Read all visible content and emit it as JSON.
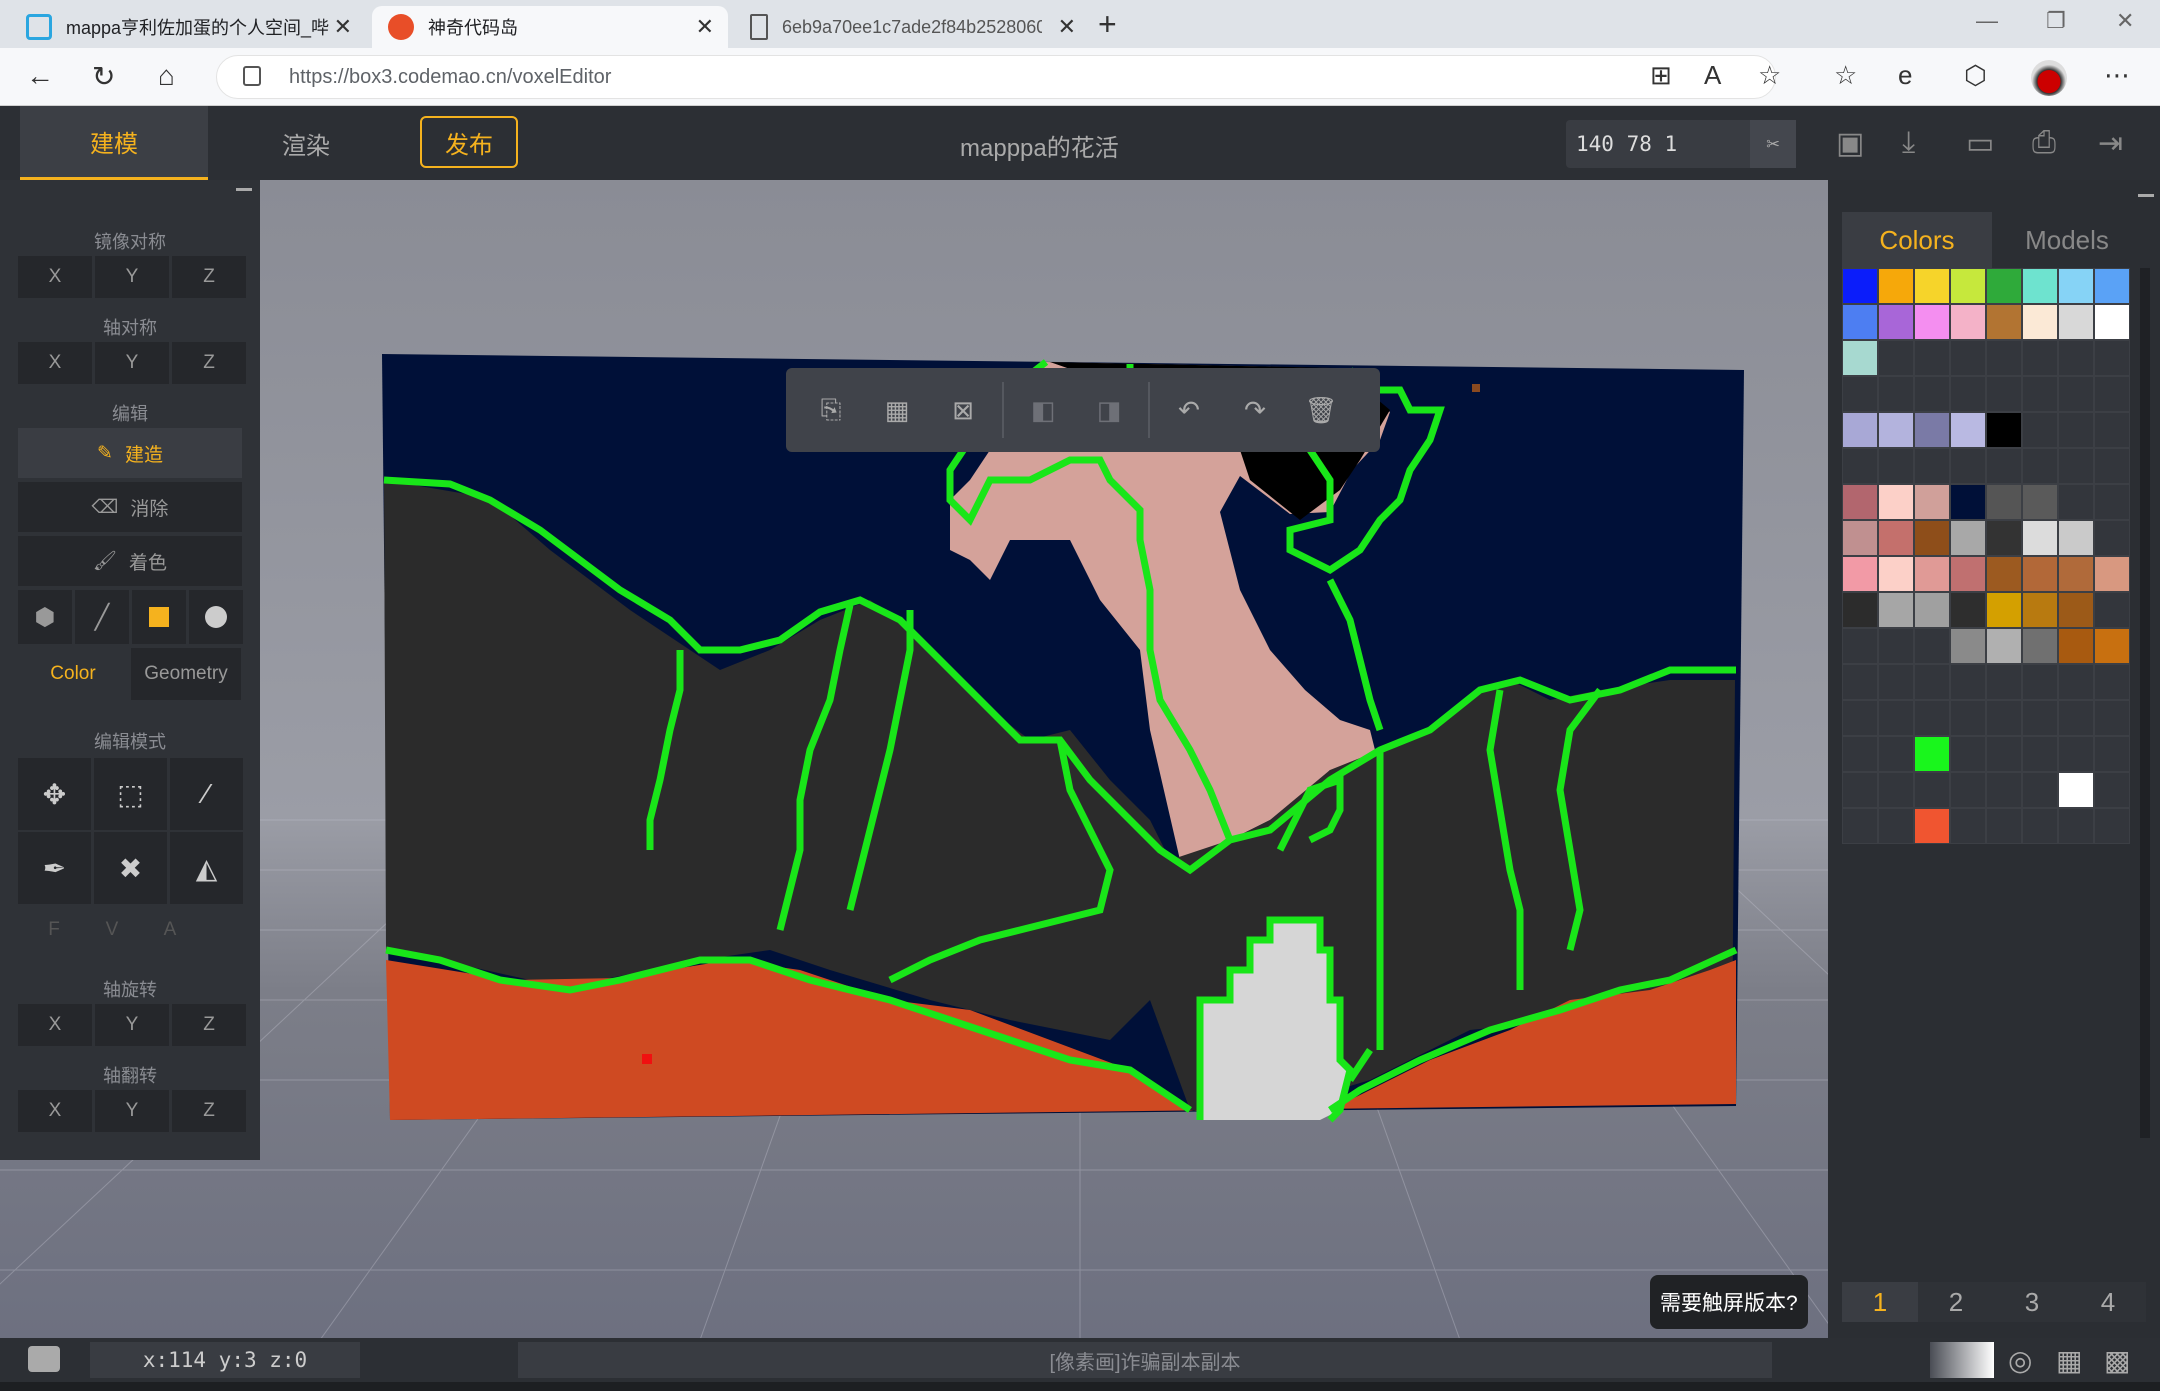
{
  "browser": {
    "tabs": [
      {
        "title": "mappa亨利佐加蛋的个人空间_哔",
        "icon": "bilibili-icon"
      },
      {
        "title": "神奇代码岛",
        "icon": "codemao-icon"
      },
      {
        "title": "6eb9a70ee1c7ade2f84b2528060",
        "icon": "file-icon"
      }
    ],
    "url": "https://box3.codemao.cn/voxelEditor"
  },
  "header": {
    "tabs": [
      "建模",
      "渲染"
    ],
    "publish_label": "发布",
    "project_name": "mapppa的花活",
    "coords": "140 78 1"
  },
  "left_panel": {
    "mirror_label": "镜像对称",
    "axis_sym_label": "轴对称",
    "edit_label": "编辑",
    "build_label": "建造",
    "erase_label": "消除",
    "paint_label": "着色",
    "color_tab": "Color",
    "geometry_tab": "Geometry",
    "edit_mode_label": "编辑模式",
    "fva": [
      "F",
      "V",
      "A"
    ],
    "axis_rotate_label": "轴旋转",
    "axis_flip_label": "轴翻转",
    "axes": [
      "X",
      "Y",
      "Z"
    ]
  },
  "right_panel": {
    "tabs": [
      "Colors",
      "Models"
    ],
    "pages": [
      "1",
      "2",
      "3",
      "4"
    ],
    "accent": "#f5b21e",
    "palette_rows": [
      [
        "#0b1dfa",
        "#f6a80a",
        "#f6d42a",
        "#c6e83c",
        "#2faa3a",
        "#6ee3cf",
        "#86d3f6",
        "#5aa2f6"
      ],
      [
        "#4d7ef2",
        "#a866d8",
        "#f48ef0",
        "#f4b2c8",
        "#b27432",
        "#fbe9d6",
        "#d8d8d8",
        "#ffffff"
      ],
      [
        "#a7d9d0",
        "",
        "",
        "",
        "",
        "",
        "",
        ""
      ],
      [
        "",
        "",
        "",
        "",
        "",
        "",
        "",
        ""
      ],
      [
        "#a8a8d6",
        "#b3b3dd",
        "#7a7aa6",
        "#b9b9e2",
        "#000000",
        "",
        "",
        ""
      ],
      [
        "",
        "",
        "",
        "",
        "",
        "",
        "",
        ""
      ],
      [
        "#b2666e",
        "#fcd0c8",
        "#d0a09a",
        "#001038",
        "#555555",
        "#5a5a5a",
        "",
        ""
      ],
      [
        "#c09090",
        "#c4706c",
        "#8e4e1a",
        "#a8a8a8",
        "#333333",
        "#dcdcdc",
        "#cacaca",
        ""
      ],
      [
        "#f29aa6",
        "#fcd0c8",
        "#e09a96",
        "#c07070",
        "#9c5a20",
        "#b26838",
        "#b06a3a",
        "#d89880"
      ],
      [
        "#2c2c2c",
        "#a6a6a6",
        "#a0a0a0",
        "#2e2e2e",
        "#d4a000",
        "#b87a10",
        "#9c5a18",
        ""
      ],
      [
        "",
        "",
        "",
        "#8a8a8a",
        "#b0b0b0",
        "#707070",
        "#a85a10",
        "#c87010"
      ],
      [
        "",
        "",
        "",
        "",
        "",
        "",
        "",
        ""
      ],
      [
        "",
        "",
        "",
        "",
        "",
        "",
        "",
        ""
      ],
      [
        "",
        "",
        "#19f61c",
        "",
        "",
        "",
        "",
        ""
      ],
      [
        "",
        "",
        "",
        "",
        "",
        "",
        "#ffffff",
        ""
      ],
      [
        "",
        "",
        "#f05530",
        "",
        "",
        "",
        "",
        ""
      ]
    ]
  },
  "tooltip": "需要触屏版本?",
  "status": {
    "xyz": "x:114 y:3 z:0",
    "info": "[像素画]诈骗副本副本"
  }
}
